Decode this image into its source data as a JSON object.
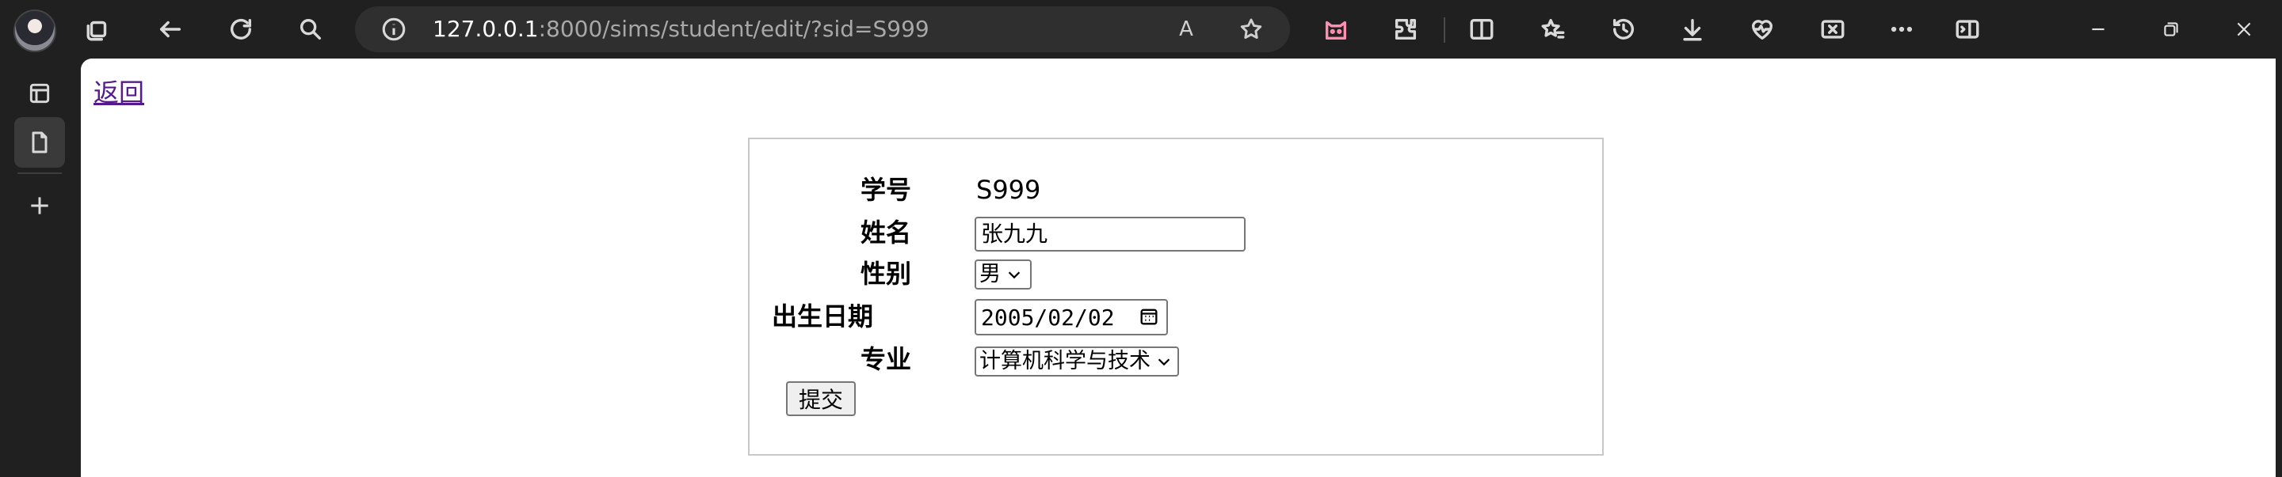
{
  "browser": {
    "url_host": "127.0.0.1",
    "url_rest": ":8000/sims/student/edit/?sid=S999",
    "read_aloud_label": "A"
  },
  "page": {
    "back_link": "返回",
    "form": {
      "sid_label": "学号",
      "sid_value": "S999",
      "name_label": "姓名",
      "name_value": "张九九",
      "gender_label": "性别",
      "gender_selected": "男",
      "birth_label": "出生日期",
      "birth_value": "2005/02/02",
      "major_label": "专业",
      "major_selected": "计算机科学与技术",
      "submit_label": "提交"
    }
  },
  "colors": {
    "chrome_bg": "#202020",
    "address_bg": "#2f2f2f",
    "visited_link": "#551a8b"
  }
}
